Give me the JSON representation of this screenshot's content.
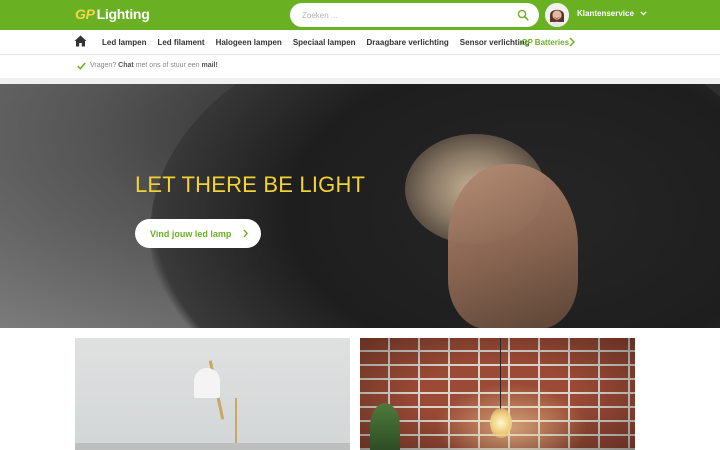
{
  "brand": {
    "logo_prefix": "GP",
    "logo_name": "Lighting",
    "accent": "#6ab023",
    "gold": "#f3d233"
  },
  "header": {
    "search_placeholder": "Zoeken ...",
    "customer_service": "Klantenservice"
  },
  "nav": {
    "items": [
      "Led lampen",
      "Led filament",
      "Halogeen lampen",
      "Speciaal lampen",
      "Draagbare verlichting",
      "Sensor verlichting"
    ],
    "gp_batteries_prefix": "GP",
    "gp_batteries_label": "Batteries"
  },
  "infobar": {
    "text_1": "Vragen?",
    "chat": "Chat",
    "text_2": "met ons of stuur een",
    "mail": "mail!"
  },
  "hero": {
    "title": "LET THERE BE LIGHT",
    "cta": "Vind jouw led lamp"
  },
  "icons": [
    "search-icon",
    "home-icon",
    "chevron-down-icon",
    "chevron-right-icon",
    "check-icon"
  ]
}
